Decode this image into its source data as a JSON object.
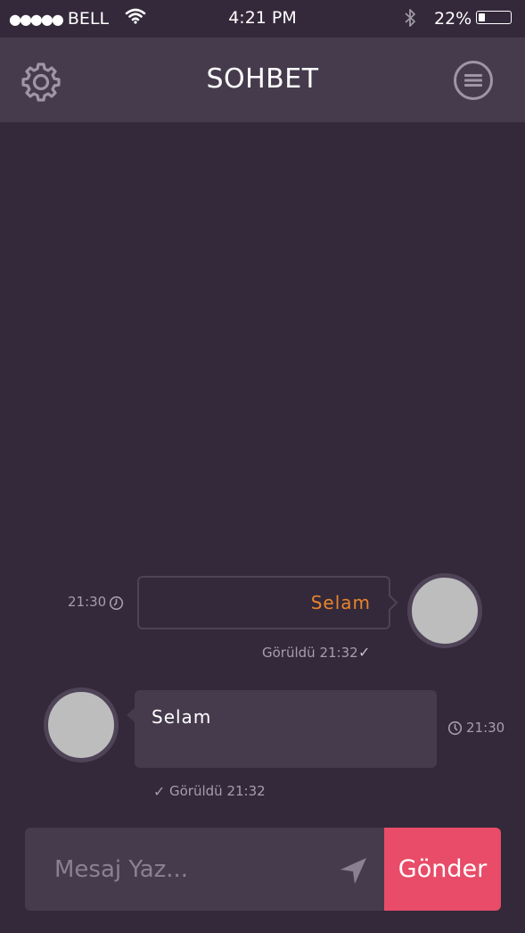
{
  "status_bar": {
    "signal": "●●●●●",
    "carrier": "BELL",
    "time": "4:21 PM",
    "battery": "22%",
    "battery_level": 0.22
  },
  "header": {
    "title": "SOHBET",
    "left_icon": "gear-icon",
    "right_icon": "menu-icon"
  },
  "messages": [
    {
      "direction": "outgoing",
      "text": "Selam",
      "time": "21:30",
      "seen": "Görüldü 21:32",
      "text_color": "#e8842c"
    },
    {
      "direction": "incoming",
      "text": "Selam",
      "time": "21:30",
      "seen": "Görüldü 21:32",
      "text_color": "#ffffff"
    }
  ],
  "composer": {
    "placeholder": "Mesaj Yaz...",
    "value": "",
    "send_label": "Gönder"
  },
  "colors": {
    "background": "#33293a",
    "header": "#463b4d",
    "accent": "#e84c68",
    "avatar": "#bdbdbd"
  }
}
